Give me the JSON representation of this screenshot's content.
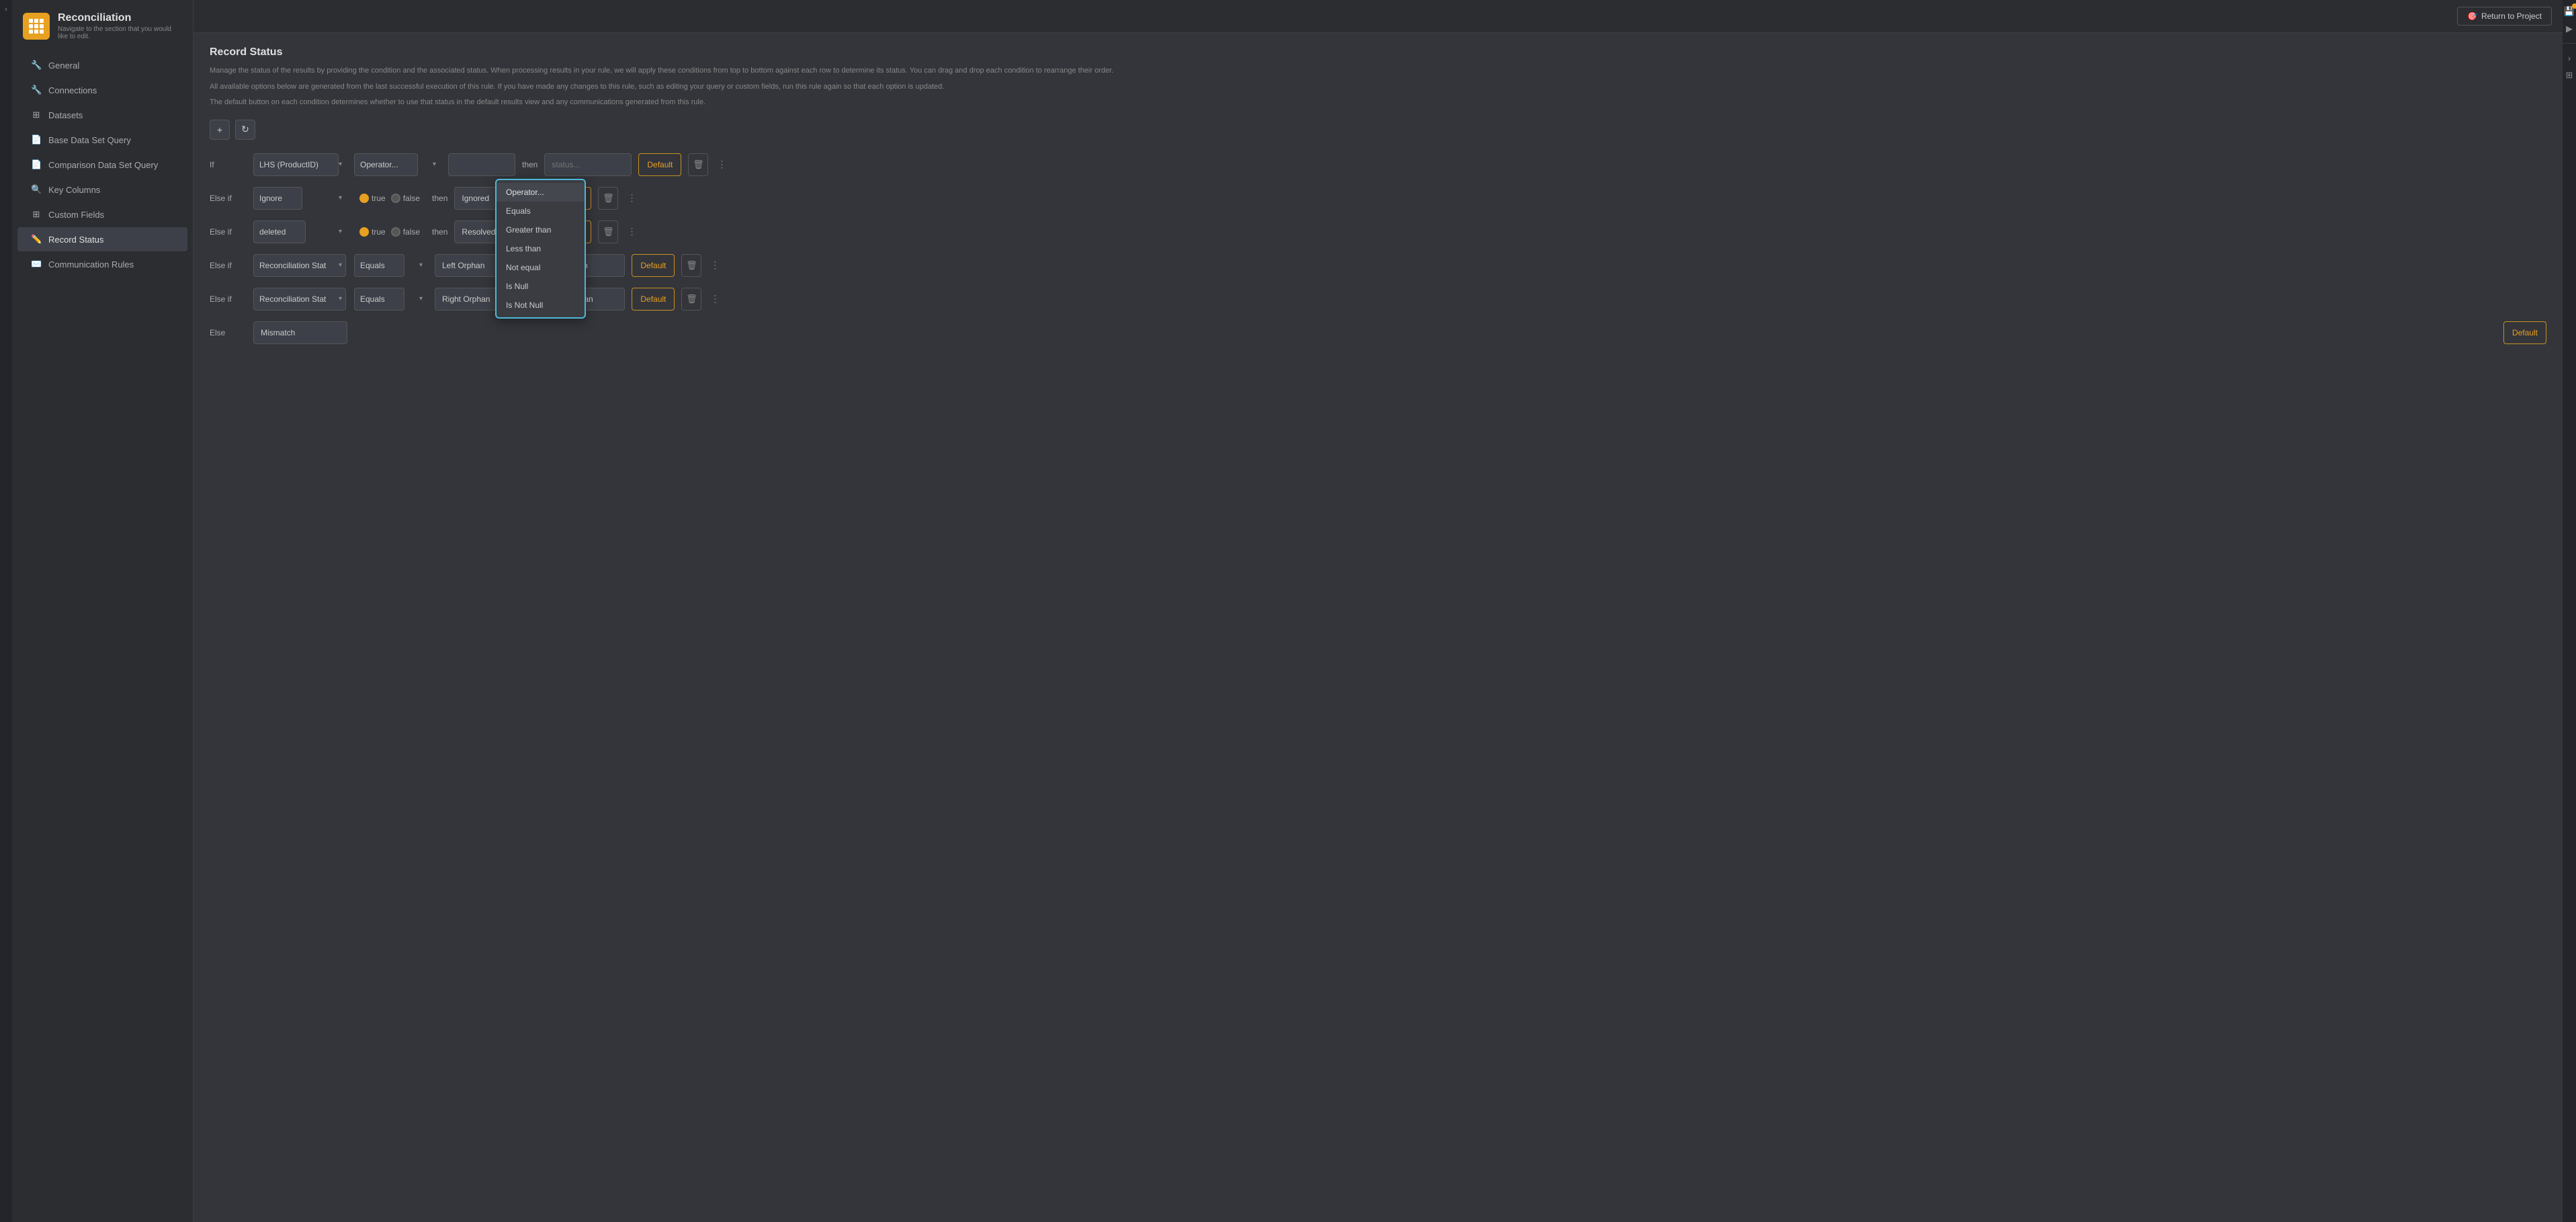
{
  "app": {
    "title": "Reconciliation",
    "subtitle": "Navigate to the section that you would like to edit.",
    "return_button": "Return to Project"
  },
  "sidebar": {
    "items": [
      {
        "id": "general",
        "label": "General",
        "icon": "🔧",
        "active": false
      },
      {
        "id": "connections",
        "label": "Connections",
        "icon": "🔧",
        "active": false
      },
      {
        "id": "datasets",
        "label": "Datasets",
        "icon": "▦",
        "active": false
      },
      {
        "id": "base-data-set-query",
        "label": "Base Data Set Query",
        "icon": "📄",
        "active": false
      },
      {
        "id": "comparison-data-set-query",
        "label": "Comparison Data Set Query",
        "icon": "📄",
        "active": false
      },
      {
        "id": "key-columns",
        "label": "Key Columns",
        "icon": "🔍",
        "active": false
      },
      {
        "id": "custom-fields",
        "label": "Custom Fields",
        "icon": "▦",
        "active": false
      },
      {
        "id": "record-status",
        "label": "Record Status",
        "icon": "✏️",
        "active": true
      },
      {
        "id": "communication-rules",
        "label": "Communication Rules",
        "icon": "✉️",
        "active": false
      }
    ]
  },
  "content": {
    "section_title": "Record Status",
    "desc1": "Manage the status of the results by providing the condition and the associated status. When processing results in your rule, we will apply these conditions from top to bottom against each row to determine its status. You can drag and drop each condition to rearrange their order.",
    "desc2": "All available options below are generated from the last successful execution of this rule. If you have made any changes to this rule, such as editing your query or custom fields, run this rule again so that each option is updated.",
    "desc3": "The default button on each condition determines whether to use that status in the default results view and any communications generated from this rule.",
    "toolbar": {
      "add": "+",
      "refresh": "↻"
    },
    "conditions": [
      {
        "id": 1,
        "row_label": "If",
        "lhs": "LHS (ProductID)",
        "operator": "Operator...",
        "rhs": "",
        "then": "then",
        "status": "status...",
        "show_default": true,
        "has_radio": false,
        "is_first": true
      },
      {
        "id": 2,
        "row_label": "Else if",
        "lhs": "Ignore",
        "operator": "",
        "rhs": "",
        "then": "then",
        "status": "Ignored",
        "radio_true": true,
        "radio_false": false,
        "show_default": true,
        "has_radio": true
      },
      {
        "id": 3,
        "row_label": "Else if",
        "lhs": "deleted",
        "operator": "",
        "rhs": "",
        "then": "then",
        "status": "Resolved",
        "radio_true": true,
        "radio_false": false,
        "show_default": true,
        "has_radio": true
      },
      {
        "id": 4,
        "row_label": "Else if",
        "lhs": "Reconciliation Stat",
        "operator": "Equals",
        "rhs": "Left Orphan",
        "then": "then",
        "status": "Left Orphan",
        "show_default": true,
        "has_radio": false
      },
      {
        "id": 5,
        "row_label": "Else if",
        "lhs": "Reconciliation Stat",
        "operator": "Equals",
        "rhs": "Right Orphan",
        "then": "then",
        "status": "Right Orphan",
        "show_default": true,
        "has_radio": false
      },
      {
        "id": 6,
        "row_label": "Else",
        "lhs": "Mismatch",
        "operator": "",
        "rhs": "",
        "then": "",
        "status": "",
        "show_default": true,
        "has_radio": false,
        "is_else": true
      }
    ],
    "dropdown": {
      "options": [
        "Operator...",
        "Equals",
        "Greater than",
        "Less than",
        "Not equal",
        "Is Null",
        "Is Not Null"
      ],
      "selected": "Operator..."
    },
    "labels": {
      "default": "Default",
      "true": "true",
      "false": "false",
      "then": "then"
    }
  }
}
